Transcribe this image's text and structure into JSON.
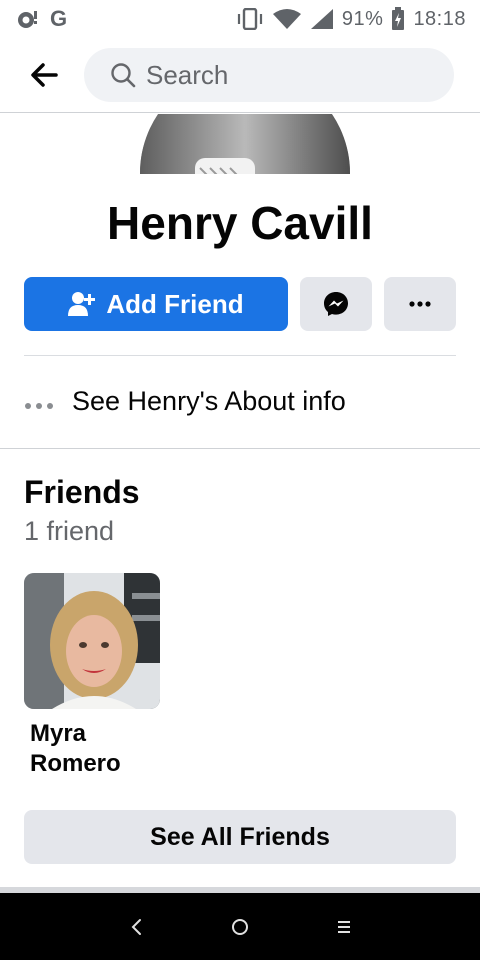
{
  "status_bar": {
    "battery": "91%",
    "time": "18:18",
    "left_icons": [
      "camera-notification-icon",
      "google-icon"
    ],
    "google_letter": "G",
    "right_icons": [
      "vibrate-icon",
      "wifi-icon",
      "signal-icon",
      "battery-icon"
    ]
  },
  "header": {
    "search_placeholder": "Search",
    "back_icon": "arrow-left-icon",
    "search_icon": "search-icon"
  },
  "profile": {
    "name": "Henry Cavill"
  },
  "actions": {
    "add_friend_label": "Add Friend",
    "add_friend_icon": "add-person-icon",
    "messenger_icon": "messenger-icon",
    "more_icon": "more-horizontal-icon"
  },
  "about": {
    "label": "See Henry's About info",
    "icon": "ellipsis-icon"
  },
  "friends": {
    "title": "Friends",
    "count_text": "1 friend",
    "items": [
      {
        "name": "Myra Romero"
      }
    ],
    "see_all_label": "See All Friends"
  },
  "navbar": {
    "back": "<",
    "home": "o",
    "recents": "="
  },
  "colors": {
    "accent": "#1b74e4",
    "grey_button": "#e4e6eb",
    "search_bg": "#f0f2f5",
    "secondary_text": "#65676b"
  }
}
